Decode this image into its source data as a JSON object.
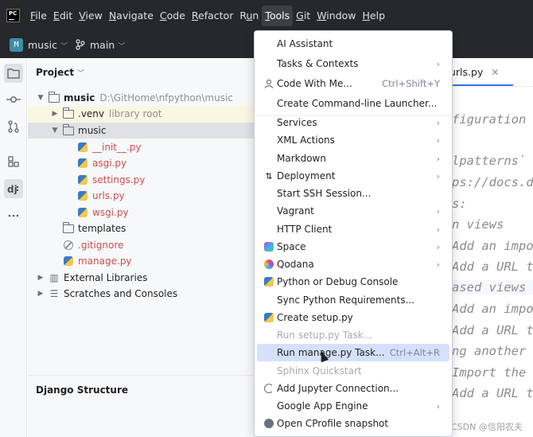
{
  "app": {
    "logo": "PC"
  },
  "menubar": {
    "items": [
      {
        "pre": "",
        "mn": "F",
        "post": "ile"
      },
      {
        "pre": "",
        "mn": "E",
        "post": "dit"
      },
      {
        "pre": "",
        "mn": "V",
        "post": "iew"
      },
      {
        "pre": "",
        "mn": "N",
        "post": "avigate"
      },
      {
        "pre": "",
        "mn": "C",
        "post": "ode"
      },
      {
        "pre": "",
        "mn": "R",
        "post": "efactor"
      },
      {
        "pre": "R",
        "mn": "u",
        "post": "n"
      },
      {
        "pre": "",
        "mn": "T",
        "post": "ools"
      },
      {
        "pre": "",
        "mn": "G",
        "post": "it"
      },
      {
        "pre": "",
        "mn": "W",
        "post": "indow"
      },
      {
        "pre": "",
        "mn": "H",
        "post": "elp"
      }
    ]
  },
  "toolbar": {
    "project_badge": "M",
    "project_name": "music",
    "branch": "main"
  },
  "project_panel": {
    "title": "Project",
    "tree": [
      {
        "name": "music",
        "extra": "D:\\GitHome\\nfpython\\music"
      },
      {
        "name": ".venv",
        "extra": "library root"
      },
      {
        "name": "music"
      },
      {
        "name": "__init__.py"
      },
      {
        "name": "asgi.py"
      },
      {
        "name": "settings.py"
      },
      {
        "name": "urls.py"
      },
      {
        "name": "wsgi.py"
      },
      {
        "name": "templates"
      },
      {
        "name": ".gitignore"
      },
      {
        "name": "manage.py"
      },
      {
        "name": "External Libraries"
      },
      {
        "name": "Scratches and Consoles"
      }
    ],
    "structure_title": "Django Structure"
  },
  "editor": {
    "tab": "urls.py",
    "code_lines": [
      "figuration",
      "lpatterns`",
      "ps://docs.d",
      "s:",
      "n views",
      "Add an impo",
      "Add a URL t",
      "ased views",
      "Add an impo",
      "Add a URL t",
      "ng another",
      "Import the",
      "Add a URL t"
    ]
  },
  "tools_menu": {
    "items": [
      {
        "label": "AI Assistant"
      },
      {
        "label": "Tasks & Contexts",
        "mn_index": 0
      },
      {
        "label": "Code With Me...",
        "shortcut": "Ctrl+Shift+Y"
      },
      {
        "label": "Create Command-line Launcher..."
      },
      {
        "label": "Services"
      },
      {
        "label": "XML Actions"
      },
      {
        "label": "Markdown"
      },
      {
        "label": "Deployment"
      },
      {
        "label": "Start SSH Session..."
      },
      {
        "label": "Vagrant"
      },
      {
        "label": "HTTP Client"
      },
      {
        "label": "Space"
      },
      {
        "label": "Qodana"
      },
      {
        "label": "Python or Debug Console"
      },
      {
        "label": "Sync Python Requirements..."
      },
      {
        "label": "Create setup.py"
      },
      {
        "label": "Run setup.py Task..."
      },
      {
        "label": "Run manage.py Task...",
        "shortcut": "Ctrl+Alt+R"
      },
      {
        "label": "Sphinx Quickstart"
      },
      {
        "label": "Add Jupyter Connection..."
      },
      {
        "label": "Google App Engine"
      },
      {
        "label": "Open CProfile snapshot"
      }
    ],
    "submenu_arrow": "›"
  },
  "watermark": "CSDN @信阳农夫",
  "colors": {
    "header_bg": "#26282c",
    "panel_bg": "#f7f8fa",
    "highlight": "#d5e1fc",
    "selection": "#dfe1e5"
  }
}
